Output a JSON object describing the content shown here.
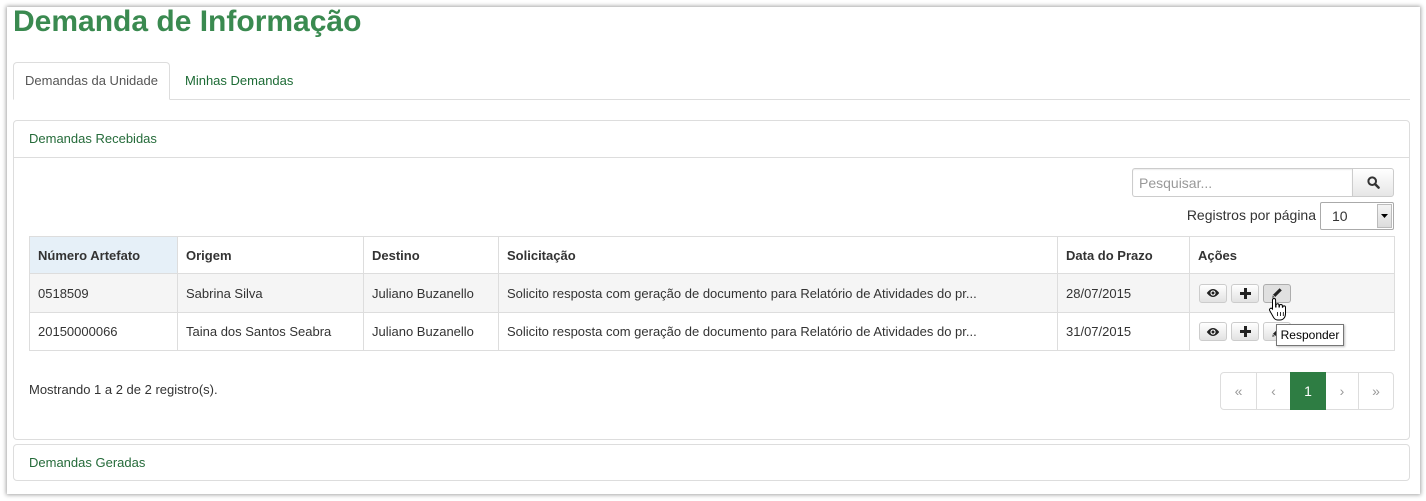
{
  "page": {
    "title": "Demanda de Informação"
  },
  "tabs": [
    {
      "label": "Demandas da Unidade",
      "active": true
    },
    {
      "label": "Minhas Demandas",
      "active": false
    }
  ],
  "received": {
    "title": "Demandas Recebidas",
    "search": {
      "placeholder": "Pesquisar...",
      "value": "",
      "button_icon": "search-icon"
    },
    "page_size": {
      "label": "Registros por página",
      "value": "10"
    },
    "table": {
      "columns": [
        "Número Artefato",
        "Origem",
        "Destino",
        "Solicitação",
        "Data do Prazo",
        "Ações"
      ],
      "rows": [
        {
          "numero": "0518509",
          "origem": "Sabrina Silva",
          "destino": "Juliano Buzanello",
          "solicitacao": "Solicito resposta com geração de documento para Relatório de Atividades do pr...",
          "prazo": "28/07/2015",
          "actions": [
            "eye-icon",
            "plus-icon",
            "pencil-icon"
          ]
        },
        {
          "numero": "20150000066",
          "origem": "Taina dos Santos Seabra",
          "destino": "Juliano Buzanello",
          "solicitacao": "Solicito resposta com geração de documento para Relatório de Atividades do pr...",
          "prazo": "31/07/2015",
          "actions": [
            "eye-icon",
            "plus-icon",
            "pencil-icon"
          ]
        }
      ]
    },
    "summary": "Mostrando 1 a 2 de 2 registro(s).",
    "pagination": {
      "first": "«",
      "prev": "‹",
      "current": "1",
      "next": "›",
      "last": "»"
    }
  },
  "tooltip": {
    "text": "Responder"
  },
  "generated": {
    "title": "Demandas Geradas"
  },
  "colors": {
    "title_green": "#3a8a50",
    "link_green": "#1d6b35",
    "active_page_bg": "#2e7d43",
    "sorted_header_bg": "#e6f0f8",
    "hover_row_bg": "#f5f5f5"
  }
}
